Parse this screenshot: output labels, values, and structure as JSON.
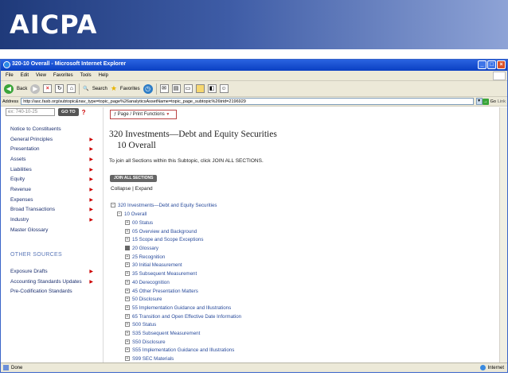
{
  "banner": {
    "logo": "AICPA"
  },
  "window": {
    "title": "320-10 Overall - Microsoft Internet Explorer",
    "buttons": {
      "minimize": "_",
      "maximize": "□",
      "close": "×"
    }
  },
  "menu": [
    "File",
    "Edit",
    "View",
    "Favorites",
    "Tools",
    "Help"
  ],
  "toolbar": {
    "back": "Back",
    "search": "Search",
    "favorites": "Favorites"
  },
  "address": {
    "label": "Address",
    "url": "http://asc.fasb.org/subtopic&nav_type=topic_page%26analyticsAssetName=topic_page_subtopic%26trid=2196929",
    "go": "Go",
    "links": "Link"
  },
  "sidebar": {
    "search_placeholder": "ex: 740-10-25",
    "goto_label": "GO TO",
    "help": "?",
    "items": [
      "Notice to Constituents",
      "General Principles",
      "Presentation",
      "Assets",
      "Liabilities",
      "Equity",
      "Revenue",
      "Expenses",
      "Broad Transactions",
      "Industry",
      "Master Glossary"
    ],
    "arrow": "▶",
    "other_sources_heading": "OTHER SOURCES",
    "other_sources": [
      "Exposure Drafts",
      "Accounting Standards Updates",
      "Pre-Codification Standards"
    ]
  },
  "main": {
    "page_print": "Page / Print Functions",
    "title_line1": "320 Investments—Debt and Equity Securities",
    "title_line2": "10 Overall",
    "intro": "To join all Sections within this Subtopic, click JOIN ALL SECTIONS.",
    "join_all": "JOIN ALL SECTIONS",
    "collapse": "Collapse",
    "sep": "|",
    "expand": "Expand",
    "tree_root": "320 Investments—Debt and Equity Securities",
    "tree_sub": "10 Overall",
    "sections": [
      "00 Status",
      "05 Overview and Background",
      "15 Scope and Scope Exceptions",
      "20 Glossary",
      "25 Recognition",
      "30 Initial Measurement",
      "35 Subsequent Measurement",
      "40 Derecognition",
      "45 Other Presentation Matters",
      "50 Disclosure",
      "55 Implementation Guidance and Illustrations",
      "65 Transition and Open Effective Date Information",
      "S00 Status",
      "S35 Subsequent Measurement",
      "S50 Disclosure",
      "S55 Implementation Guidance and Illustrations",
      "S99 SEC Materials"
    ]
  },
  "status": {
    "left": "Done",
    "zone": "Internet"
  }
}
